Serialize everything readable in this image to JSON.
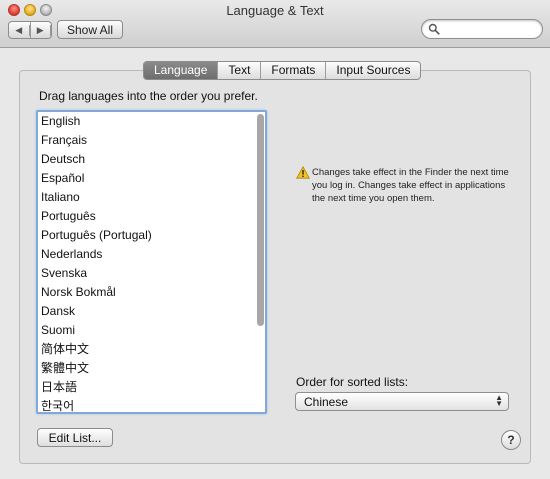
{
  "window": {
    "title": "Language & Text"
  },
  "toolbar": {
    "back_icon": "triangle-left",
    "forward_icon": "triangle-right",
    "show_all_label": "Show All",
    "search": {
      "value": "",
      "placeholder": ""
    }
  },
  "tabs": [
    {
      "label": "Language",
      "selected": true
    },
    {
      "label": "Text",
      "selected": false
    },
    {
      "label": "Formats",
      "selected": false
    },
    {
      "label": "Input Sources",
      "selected": false
    }
  ],
  "language_pane": {
    "instruction": "Drag languages into the order you prefer.",
    "languages": [
      "English",
      "Français",
      "Deutsch",
      "Español",
      "Italiano",
      "Português",
      "Português (Portugal)",
      "Nederlands",
      "Svenska",
      "Norsk Bokmål",
      "Dansk",
      "Suomi",
      "简体中文",
      "繁體中文",
      "日本語",
      "한국어"
    ],
    "warning_text": "Changes take effect in the Finder the next time you log in. Changes take effect in applications the next time you open them.",
    "sorted_lists_label": "Order for sorted lists:",
    "sorted_lists_value": "Chinese",
    "edit_list_label": "Edit List...",
    "help_label": "?"
  },
  "colors": {
    "selected_tab": "#7c7c7c",
    "focus_ring": "#7fa9d8",
    "warning_yellow": "#f2c419"
  }
}
